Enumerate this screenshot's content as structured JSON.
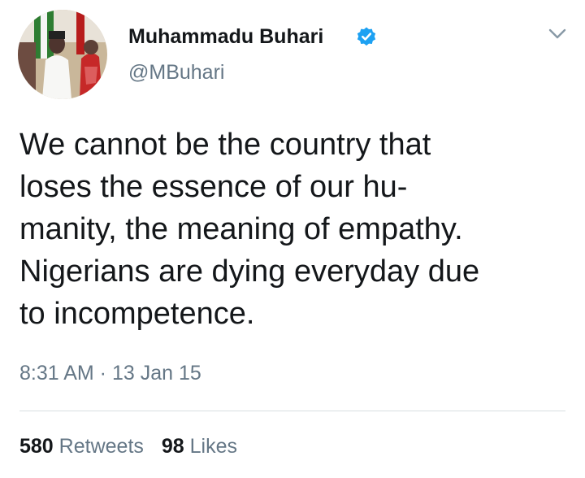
{
  "tweet": {
    "author": {
      "display_name": "Muhammadu Buhari",
      "handle": "@MBuhari",
      "verified": true,
      "verified_icon": "verified-badge-icon"
    },
    "menu_icon": "chevron-down-icon",
    "text_lines": [
      "We cannot be the country that",
      "loses the essence of our hu-",
      "manity, the meaning of empathy.",
      "Nigerians are dying everyday due",
      "to incompetence."
    ],
    "timestamp": "8:31 AM · 13 Jan 15",
    "stats": {
      "retweets_count": "580",
      "retweets_label": "Retweets",
      "likes_count": "98",
      "likes_label": "Likes"
    }
  },
  "colors": {
    "text": "#14171a",
    "secondary": "#657786",
    "verified_blue": "#1da1f2",
    "divider": "#d9dee2"
  }
}
